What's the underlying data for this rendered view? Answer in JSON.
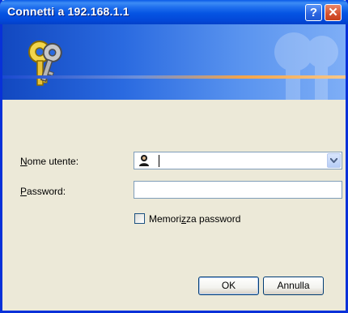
{
  "window": {
    "title": "Connetti a 192.168.1.1",
    "help_label": "?",
    "close_label": "✕"
  },
  "form": {
    "username_label_key": "N",
    "username_label_rest": "ome utente:",
    "username_value": "",
    "password_label_key": "P",
    "password_label_rest": "assword:",
    "password_value": "",
    "remember_label_pre": "Memori",
    "remember_label_key": "z",
    "remember_label_post": "za password",
    "remember_checked": false
  },
  "buttons": {
    "ok_label": "OK",
    "cancel_label": "Annulla"
  },
  "colors": {
    "titlebar": "#0554e3",
    "close": "#d5512f",
    "dialog_bg": "#ece9d8"
  },
  "icons": [
    "keys-icon",
    "help-icon",
    "close-icon",
    "user-icon",
    "chevron-down-icon"
  ]
}
